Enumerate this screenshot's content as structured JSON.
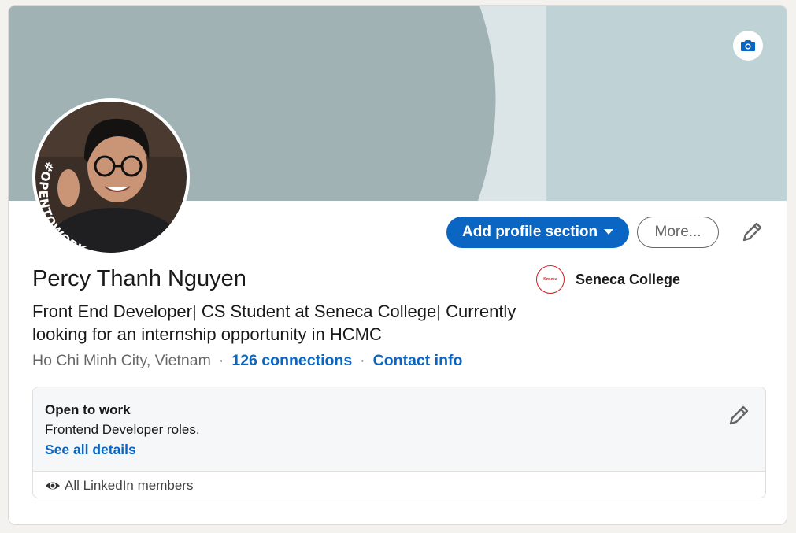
{
  "profile": {
    "name": "Percy Thanh Nguyen",
    "headline": "Front End Developer| CS Student at Seneca College| Currently looking for an internship opportunity in HCMC",
    "location": "Ho Chi Minh City, Vietnam",
    "connections": "126 connections",
    "contact_info": "Contact info",
    "avatar_badge": "#OPENTOWORK"
  },
  "actions": {
    "add_section": "Add profile section",
    "more": "More..."
  },
  "education": {
    "school_name": "Seneca College",
    "logo_text": "Seneca"
  },
  "open_to_work": {
    "title": "Open to work",
    "roles": "Frontend Developer roles.",
    "details_link": "See all details",
    "visibility": "All LinkedIn members"
  },
  "icons": {
    "camera": "camera-icon",
    "edit": "pencil-icon",
    "caret": "caret-down-icon",
    "visibility": "eye-icon"
  },
  "colors": {
    "primary": "#0a66c2",
    "otw_green": "#3c7a2e",
    "banner_left": "#a0b2b4",
    "banner_right": "#bfd2d5"
  }
}
